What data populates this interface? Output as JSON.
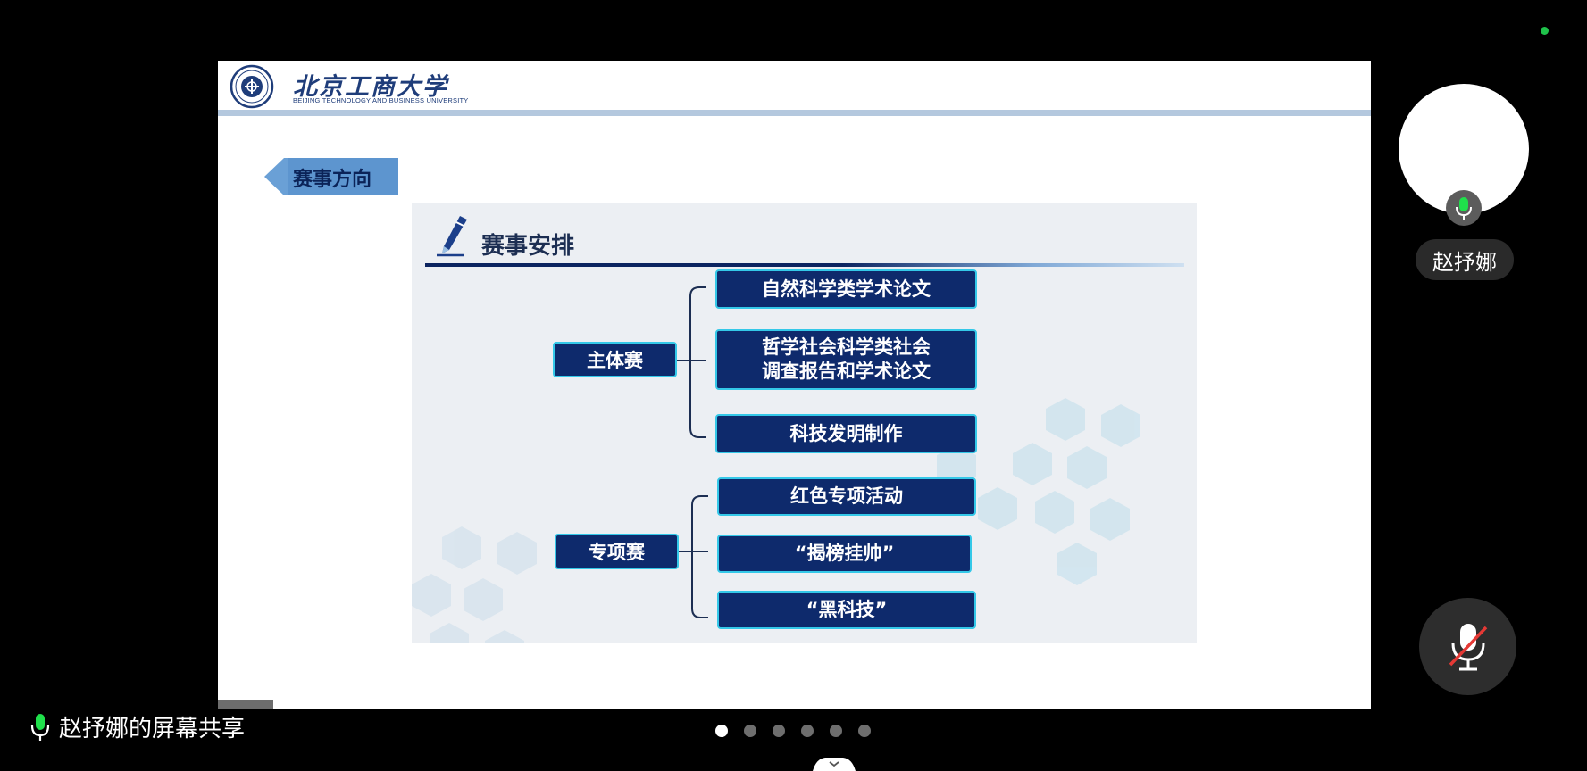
{
  "slide": {
    "logo": {
      "name_cn": "北京工商大学",
      "name_en": "BEIJING TECHNOLOGY AND BUSINESS UNIVERSITY"
    },
    "section_tag": "赛事方向",
    "panel_title": "赛事安排",
    "categories": [
      {
        "label": "主体赛",
        "items": [
          "自然科学类学术论文",
          "哲学社会科学类社会\n调查报告和学术论文",
          "科技发明制作"
        ]
      },
      {
        "label": "专项赛",
        "items": [
          "红色专项活动",
          "“揭榜挂帅”",
          "“黑科技”"
        ]
      }
    ]
  },
  "participant": {
    "name": "赵抒娜",
    "mic_icon": "mic-active-icon"
  },
  "share": {
    "label": "赵抒娜的屏幕共享",
    "icon": "mic-green-icon"
  },
  "controls": {
    "mute_icon": "mic-muted-icon"
  },
  "pagination": {
    "count": 6,
    "active_index": 0
  },
  "colors": {
    "box_fill": "#0e2a6c",
    "box_border": "#34c8e8",
    "accent_green": "#1fc24b"
  }
}
